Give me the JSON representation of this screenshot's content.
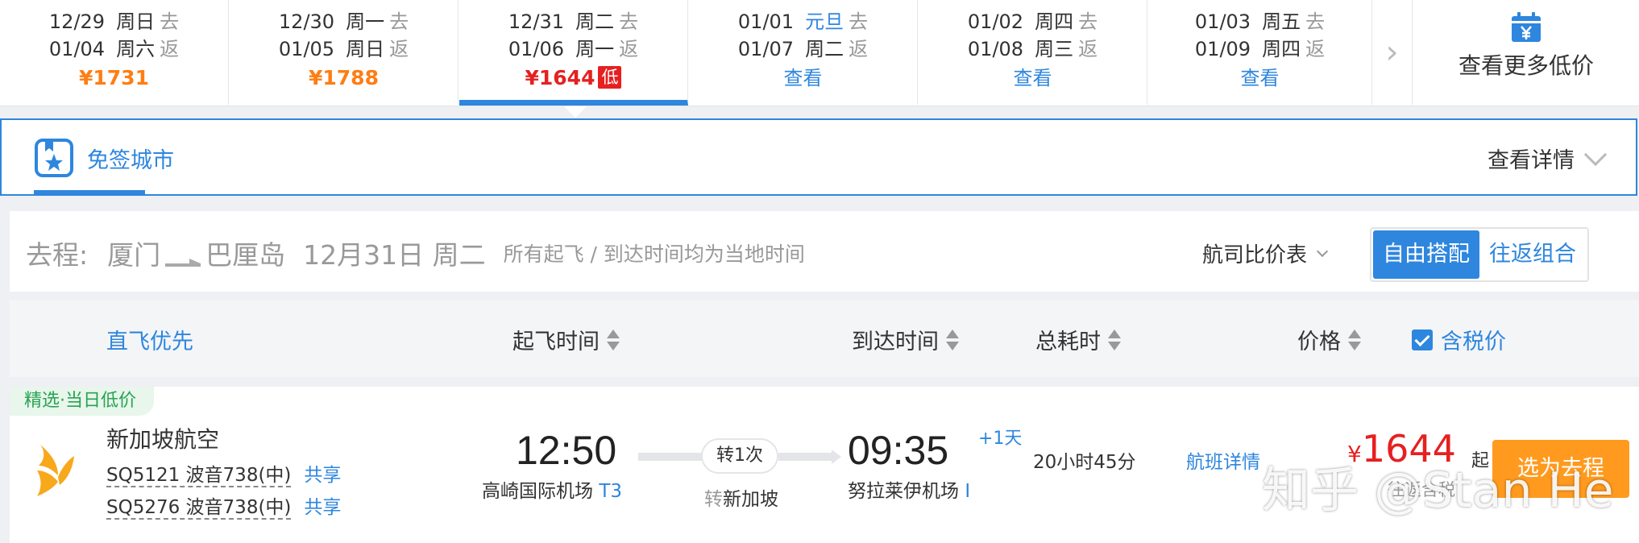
{
  "date_strip": {
    "cells": [
      {
        "dep_date": "12/29",
        "dep_week": "周日",
        "dep_dir": "去",
        "ret_date": "01/04",
        "ret_week": "周六",
        "ret_dir": "返",
        "price": "¥1731",
        "view": "",
        "badge": ""
      },
      {
        "dep_date": "12/30",
        "dep_week": "周一",
        "dep_dir": "去",
        "ret_date": "01/05",
        "ret_week": "周日",
        "ret_dir": "返",
        "price": "¥1788",
        "view": "",
        "badge": ""
      },
      {
        "dep_date": "12/31",
        "dep_week": "周二",
        "dep_dir": "去",
        "ret_date": "01/06",
        "ret_week": "周一",
        "ret_dir": "返",
        "price": "¥1644",
        "view": "",
        "badge": "低"
      },
      {
        "dep_date": "01/01",
        "dep_week": "元旦",
        "dep_dir": "去",
        "ret_date": "01/07",
        "ret_week": "周二",
        "ret_dir": "返",
        "price": "",
        "view": "查看",
        "badge": ""
      },
      {
        "dep_date": "01/02",
        "dep_week": "周四",
        "dep_dir": "去",
        "ret_date": "01/08",
        "ret_week": "周三",
        "ret_dir": "返",
        "price": "",
        "view": "查看",
        "badge": ""
      },
      {
        "dep_date": "01/03",
        "dep_week": "周五",
        "dep_dir": "去",
        "ret_date": "01/09",
        "ret_week": "周四",
        "ret_dir": "返",
        "price": "",
        "view": "查看",
        "badge": ""
      }
    ],
    "next_glyph": "›",
    "more_label": "查看更多低价"
  },
  "visa_bar": {
    "tab_label": "免签城市",
    "detail_label": "查看详情"
  },
  "route": {
    "direction": "去程:",
    "from": "厦门",
    "to": "巴厘岛",
    "date": "12月31日 周二",
    "note": "所有起飞 / 到达时间均为当地时间",
    "compare_label": "航司比价表",
    "toggle": [
      "自由搭配",
      "往返组合"
    ]
  },
  "sort": {
    "direct_first": "直飞优先",
    "depart_time": "起飞时间",
    "arrive_time": "到达时间",
    "duration": "总耗时",
    "price": "价格",
    "tax_label": "含税价"
  },
  "flight": {
    "tag": "精选·当日低价",
    "airline": "新加坡航空",
    "legs": [
      {
        "number": "SQ5121 波音738(中)",
        "share": "共享"
      },
      {
        "number": "SQ5276 波音738(中)",
        "share": "共享"
      }
    ],
    "dep_time": "12:50",
    "dep_airport": "高崎国际机场",
    "dep_terminal": "T3",
    "transfer_label": "转1次",
    "transfer_prefix": "转",
    "transfer_city": "新加坡",
    "arr_time": "09:35",
    "plus_day": "+1天",
    "arr_airport": "努拉莱伊机场",
    "arr_terminal": "I",
    "duration": "20小时45分",
    "detail_link": "航班详情",
    "price_yen": "¥",
    "price": "1644",
    "price_suffix": "起",
    "price_note": "往返含税",
    "select_label": "选为去程"
  },
  "watermark": "知乎 @Stan He",
  "colors": {
    "accent": "#2e86de",
    "price_orange": "#ff7d13",
    "price_red": "#e62020",
    "button_orange": "#ff9a1e",
    "tag_green": "#27a351"
  }
}
